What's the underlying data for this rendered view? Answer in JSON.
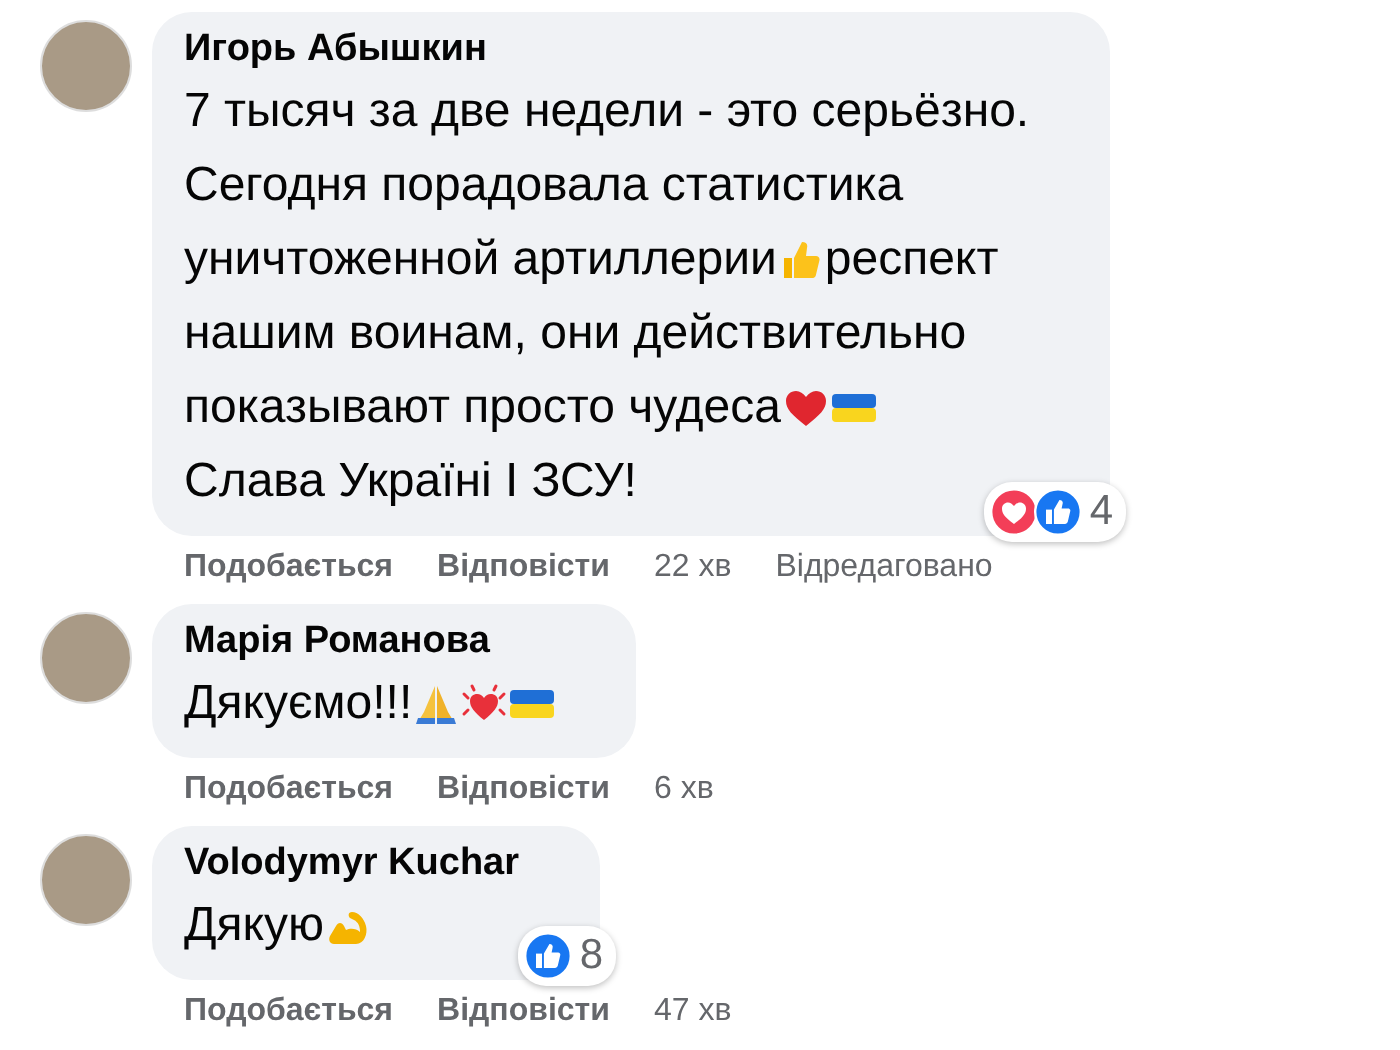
{
  "comments": [
    {
      "author": "Игорь Абышкин",
      "lines": [
        [
          {
            "kind": "text",
            "text": "7 тысяч за две недели - это серьёзно."
          }
        ],
        [
          {
            "kind": "text",
            "text": "Сегодня порадовала статистика"
          }
        ],
        [
          {
            "kind": "text",
            "text": "уничтоженной артиллерии"
          },
          {
            "kind": "thumb"
          },
          {
            "kind": "text",
            "text": "респект"
          }
        ],
        [
          {
            "kind": "text",
            "text": "нашим воинам, они действительно"
          }
        ],
        [
          {
            "kind": "text",
            "text": "показывают просто чудеса"
          },
          {
            "kind": "heart"
          },
          {
            "kind": "flag"
          }
        ],
        [
          {
            "kind": "text",
            "text": "Слава Україні І ЗСУ!"
          }
        ]
      ],
      "reactions": {
        "types": [
          {
            "kind": "love"
          },
          {
            "kind": "like"
          }
        ],
        "count": "4"
      },
      "actions": [
        {
          "kind": "link",
          "text": "Подобається"
        },
        {
          "kind": "link",
          "text": "Відповісти"
        },
        {
          "kind": "time",
          "text": "22 хв"
        },
        {
          "kind": "note",
          "text": "Відредаговано"
        }
      ]
    },
    {
      "author": "Марія Романова",
      "lines": [
        [
          {
            "kind": "text",
            "text": "Дякуємо!!!"
          },
          {
            "kind": "pray"
          },
          {
            "kind": "sparkle-heart"
          },
          {
            "kind": "flag"
          }
        ]
      ],
      "actions": [
        {
          "kind": "link",
          "text": "Подобається"
        },
        {
          "kind": "link",
          "text": "Відповісти"
        },
        {
          "kind": "time",
          "text": "6 хв"
        }
      ]
    },
    {
      "author": "Volodymyr Kuchar",
      "lines": [
        [
          {
            "kind": "text",
            "text": "Дякую"
          },
          {
            "kind": "muscle"
          }
        ]
      ],
      "reactions": {
        "types": [
          {
            "kind": "like"
          }
        ],
        "count": "8"
      },
      "actions": [
        {
          "kind": "link",
          "text": "Подобається"
        },
        {
          "kind": "link",
          "text": "Відповісти"
        },
        {
          "kind": "time",
          "text": "47 хв"
        }
      ]
    }
  ]
}
